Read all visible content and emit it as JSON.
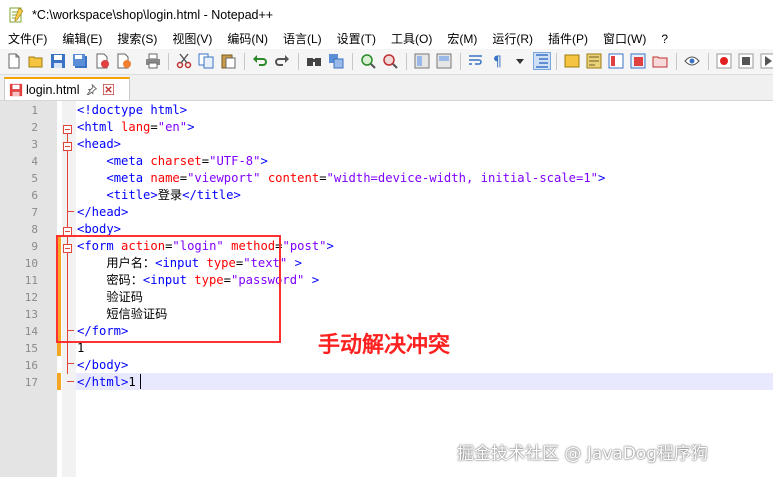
{
  "window": {
    "title": "*C:\\workspace\\shop\\login.html - Notepad++"
  },
  "menu": [
    "文件(F)",
    "编辑(E)",
    "搜索(S)",
    "视图(V)",
    "编码(N)",
    "语言(L)",
    "设置(T)",
    "工具(O)",
    "宏(M)",
    "运行(R)",
    "插件(P)",
    "窗口(W)",
    "?"
  ],
  "tab": {
    "label": "login.html"
  },
  "line_numbers": [
    "1",
    "2",
    "3",
    "4",
    "5",
    "6",
    "7",
    "8",
    "9",
    "10",
    "11",
    "12",
    "13",
    "14",
    "15",
    "16",
    "17"
  ],
  "code_lines": [
    [
      [
        "t",
        "<!doctype html>"
      ]
    ],
    [
      [
        "t",
        "<html "
      ],
      [
        "a",
        "lang"
      ],
      [
        "p",
        "="
      ],
      [
        "v",
        "\"en\""
      ],
      [
        "t",
        ">"
      ]
    ],
    [
      [
        "t",
        "<head>"
      ]
    ],
    [
      [
        "p",
        "    "
      ],
      [
        "t",
        "<meta "
      ],
      [
        "a",
        "charset"
      ],
      [
        "p",
        "="
      ],
      [
        "v",
        "\"UTF-8\""
      ],
      [
        "t",
        ">"
      ]
    ],
    [
      [
        "p",
        "    "
      ],
      [
        "t",
        "<meta "
      ],
      [
        "a",
        "name"
      ],
      [
        "p",
        "="
      ],
      [
        "v",
        "\"viewport\""
      ],
      [
        "p",
        " "
      ],
      [
        "a",
        "content"
      ],
      [
        "p",
        "="
      ],
      [
        "v",
        "\"width=device-width, initial-scale=1\""
      ],
      [
        "t",
        ">"
      ]
    ],
    [
      [
        "p",
        "    "
      ],
      [
        "t",
        "<title>"
      ],
      [
        "p",
        "登录"
      ],
      [
        "t",
        "</title>"
      ]
    ],
    [
      [
        "t",
        "</head>"
      ]
    ],
    [
      [
        "t",
        "<body>"
      ]
    ],
    [
      [
        "t",
        "<form "
      ],
      [
        "a",
        "action"
      ],
      [
        "p",
        "="
      ],
      [
        "v",
        "\"login\""
      ],
      [
        "p",
        " "
      ],
      [
        "a",
        "method"
      ],
      [
        "p",
        "="
      ],
      [
        "v",
        "\"post\""
      ],
      [
        "t",
        ">"
      ]
    ],
    [
      [
        "p",
        "    用户名："
      ],
      [
        "t",
        "<input "
      ],
      [
        "a",
        "type"
      ],
      [
        "p",
        "="
      ],
      [
        "v",
        "\"text\""
      ],
      [
        "p",
        " "
      ],
      [
        "t",
        ">"
      ]
    ],
    [
      [
        "p",
        "    密码："
      ],
      [
        "t",
        "<input "
      ],
      [
        "a",
        "type"
      ],
      [
        "p",
        "="
      ],
      [
        "v",
        "\"password\""
      ],
      [
        "p",
        " "
      ],
      [
        "t",
        ">"
      ]
    ],
    [
      [
        "p",
        "    验证码"
      ]
    ],
    [
      [
        "p",
        "    短信验证码"
      ]
    ],
    [
      [
        "t",
        "</form>"
      ]
    ],
    [
      [
        "p",
        "1"
      ]
    ],
    [
      [
        "t",
        "</body>"
      ]
    ],
    [
      [
        "t",
        "</html>"
      ],
      [
        "p",
        "1"
      ]
    ]
  ],
  "annotation": "手动解决冲突",
  "watermark": "掘金技术社区 @ JavaDog程序狗"
}
